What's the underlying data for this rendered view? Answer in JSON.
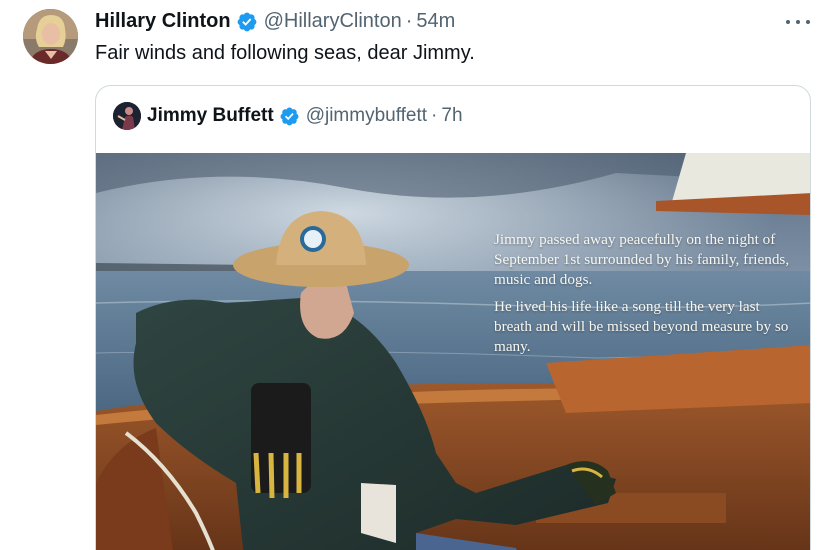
{
  "tweet": {
    "author_name": "Hillary Clinton",
    "author_handle": "@HillaryClinton",
    "separator": "·",
    "time": "54m",
    "text": "Fair winds and following seas, dear Jimmy.",
    "avatar_icon": "profile-photo"
  },
  "quoted": {
    "author_name": "Jimmy Buffett",
    "author_handle": "@jimmybuffett",
    "separator": "·",
    "time": "7h",
    "image_text": {
      "paragraph1": "Jimmy passed away peacefully on the night of September 1st surrounded by his family, friends, music and dogs.",
      "paragraph2": "He lived his life like a song till the very last breath and will be missed beyond measure by so many."
    }
  },
  "icons": {
    "verified": "verified-badge-icon",
    "more": "more-options-icon"
  },
  "colors": {
    "verified_blue": "#1d9bf0",
    "secondary_text": "#536471",
    "border": "#cfd9de"
  }
}
